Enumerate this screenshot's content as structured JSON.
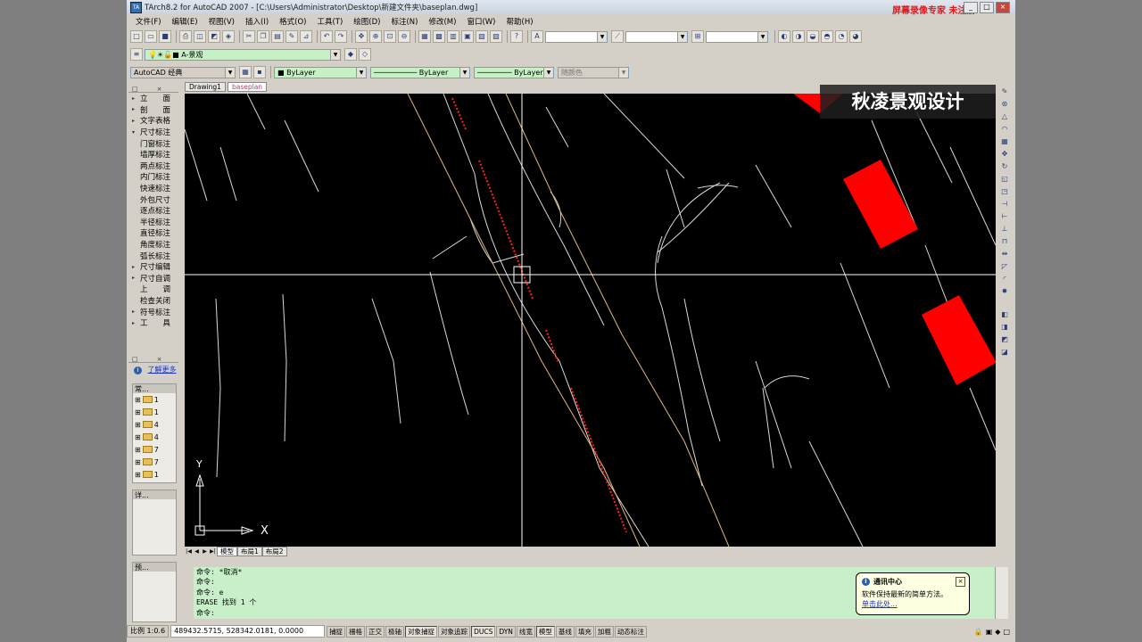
{
  "window": {
    "title": "TArch8.2 for AutoCAD 2007 - [C:\\Users\\Administrator\\Desktop\\新建文件夹\\baseplan.dwg]",
    "watermark": "屏幕录像专家 未注册",
    "buttons": [
      "_",
      "□",
      "×"
    ]
  },
  "menu": [
    "文件(F)",
    "编辑(E)",
    "视图(V)",
    "插入(I)",
    "格式(O)",
    "工具(T)",
    "绘图(D)",
    "标注(N)",
    "修改(M)",
    "窗口(W)",
    "帮助(H)"
  ],
  "toolbar2": {
    "layer": "A-景观"
  },
  "toolbar3": {
    "workspace": "AutoCAD 经典",
    "color": "ByLayer",
    "linetype": "ByLayer",
    "lineweight": "ByLayer",
    "plotstyle": "随颜色"
  },
  "left_panel": {
    "items": [
      {
        "mark": "▸",
        "label": "立　　面"
      },
      {
        "mark": "▸",
        "label": "剖　　面"
      },
      {
        "mark": "▸",
        "label": "文字表格"
      },
      {
        "mark": "▾",
        "label": "尺寸标注"
      },
      {
        "mark": "",
        "label": "门窗标注"
      },
      {
        "mark": "",
        "label": "墙厚标注"
      },
      {
        "mark": "",
        "label": "两点标注"
      },
      {
        "mark": "",
        "label": "内门标注"
      },
      {
        "mark": "",
        "label": "快速标注"
      },
      {
        "mark": "",
        "label": "外包尺寸"
      },
      {
        "mark": "",
        "label": "逐点标注"
      },
      {
        "mark": "",
        "label": "半径标注"
      },
      {
        "mark": "",
        "label": "直径标注"
      },
      {
        "mark": "",
        "label": "角度标注"
      },
      {
        "mark": "",
        "label": "弧长标注"
      },
      {
        "mark": "▸",
        "label": "尺寸编辑"
      },
      {
        "mark": "▸",
        "label": "尺寸自调"
      },
      {
        "mark": "",
        "label": "上　　调"
      },
      {
        "mark": "",
        "label": "检查关闭"
      },
      {
        "mark": "▸",
        "label": "符号标注"
      },
      {
        "mark": "▸",
        "label": "工　　具"
      }
    ],
    "info_link": "了解更多",
    "tree_title": "常...",
    "tree_rows": [
      "1",
      "1",
      "4",
      "4",
      "7",
      "7",
      "1"
    ],
    "detail_title": "详...",
    "preview_title": "预..."
  },
  "doc_tabs": [
    "Drawing1",
    "baseplan"
  ],
  "brand": "秋凌景观设计",
  "axis": {
    "y": "Y",
    "x": "X"
  },
  "layout_tabs": [
    "模型",
    "布局1",
    "布局2"
  ],
  "command_lines": [
    "命令: *取消*",
    "命令:",
    "命令: e",
    "ERASE 找到 1 个",
    "命令:"
  ],
  "balloon": {
    "title": "通讯中心",
    "text": "软件保持最新的简单方法。",
    "link": "单击此处..."
  },
  "status": {
    "scale": "比例 1:0.6",
    "coords": "489432.5715, 528342.0181, 0.0000",
    "buttons": [
      "捕捉",
      "栅格",
      "正交",
      "极轴",
      "对象捕捉",
      "对象追踪",
      "DUCS",
      "DYN",
      "线宽",
      "模型",
      "基线",
      "填充",
      "加粗",
      "动态标注"
    ]
  },
  "colors": {
    "canvas": "#000000",
    "red_block": "#ff0000",
    "cmd_bg": "#c8f0c8"
  }
}
